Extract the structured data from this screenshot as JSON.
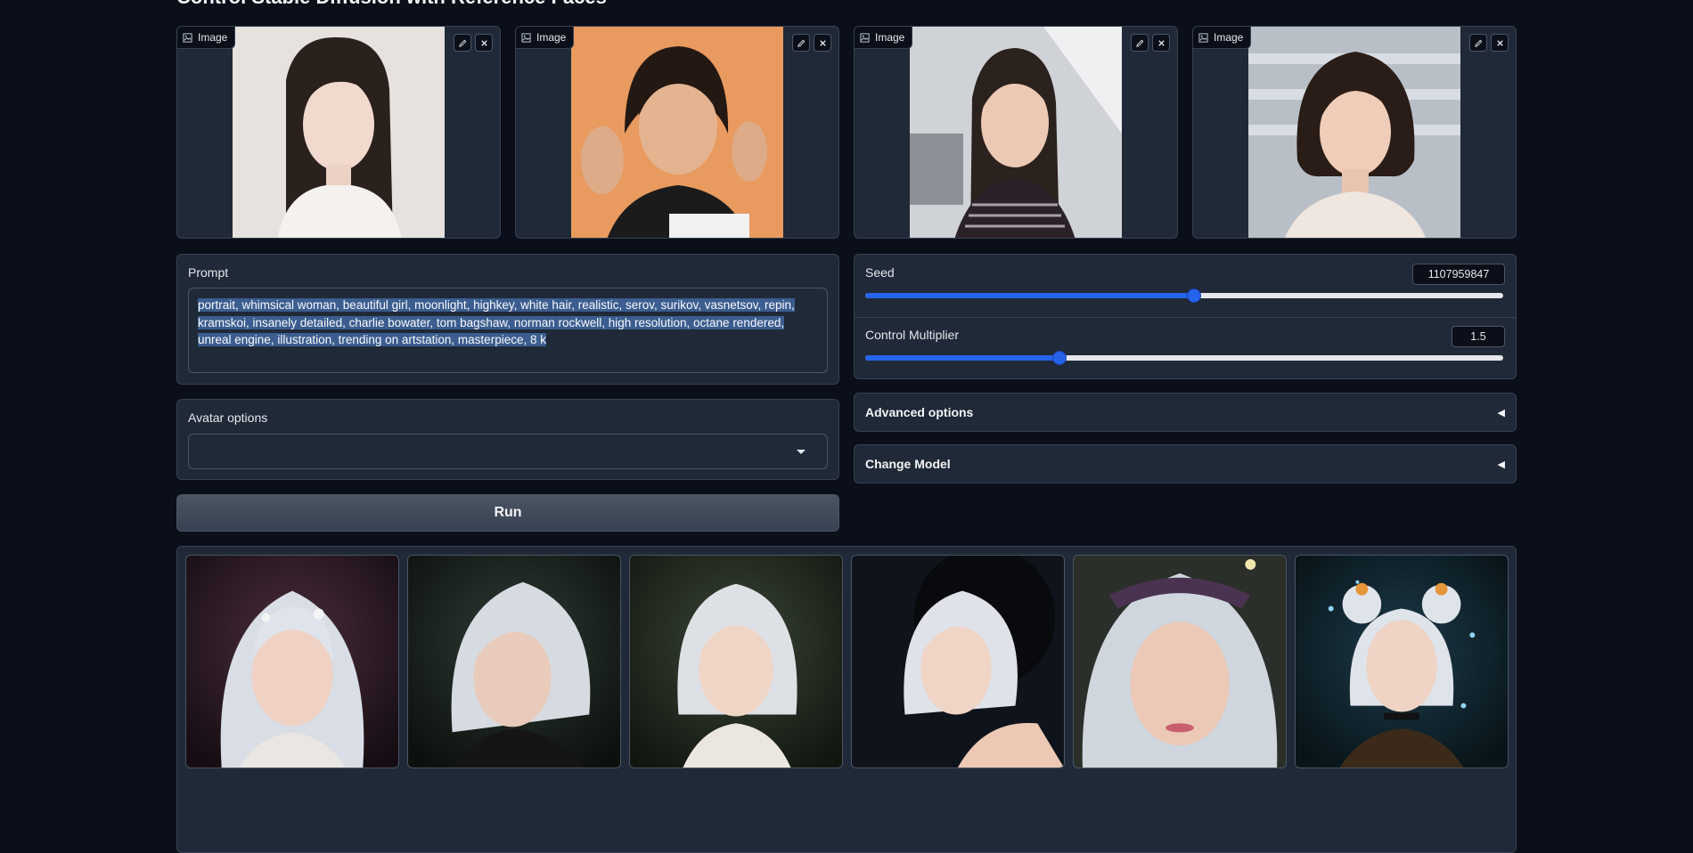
{
  "page_title": "Control Stable Diffusion with Reference Faces",
  "image_inputs": [
    {
      "label": "Image"
    },
    {
      "label": "Image"
    },
    {
      "label": "Image"
    },
    {
      "label": "Image"
    }
  ],
  "prompt": {
    "label": "Prompt",
    "value": "portrait, whimsical woman, beautiful girl, moonlight, highkey, white hair, realistic, serov, surikov, vasnetsov, repin, kramskoi, insanely detailed, charlie bowater, tom bagshaw, norman rockwell, high resolution, octane rendered, unreal engine, illustration, trending on artstation, masterpiece, 8 k"
  },
  "avatar_options": {
    "label": "Avatar options",
    "value": ""
  },
  "run_button": {
    "label": "Run"
  },
  "seed": {
    "label": "Seed",
    "value": "1107959847",
    "fraction": 0.516
  },
  "control_multiplier": {
    "label": "Control Multiplier",
    "value": "1.5",
    "fraction": 0.305
  },
  "advanced_options": {
    "label": "Advanced options",
    "arrow": "◀"
  },
  "change_model": {
    "label": "Change Model",
    "arrow": "◀"
  },
  "gallery": {
    "count": 6
  },
  "colors": {
    "background": "#0b0f19",
    "panel": "#1f2937",
    "accent": "#2563eb",
    "selection": "#3b5d8f"
  }
}
